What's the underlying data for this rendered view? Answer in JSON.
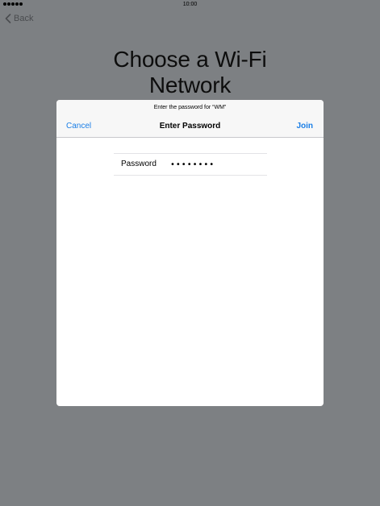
{
  "status_bar": {
    "signal_dots": 5,
    "time": "10:00"
  },
  "nav": {
    "back_label": "Back",
    "back_icon": "chevron-left-icon"
  },
  "page": {
    "title_line1": "Choose a Wi-Fi",
    "title_line2": "Network"
  },
  "dialog": {
    "prompt": "Enter the password for “WM”",
    "title": "Enter Password",
    "cancel_label": "Cancel",
    "join_label": "Join",
    "password_label": "Password",
    "password_value": "abcdefgh"
  },
  "colors": {
    "accent": "#1a7ee6",
    "backdrop": "#7d8083",
    "dialog_background": "#ffffff",
    "header_background": "#f7f7f7"
  }
}
